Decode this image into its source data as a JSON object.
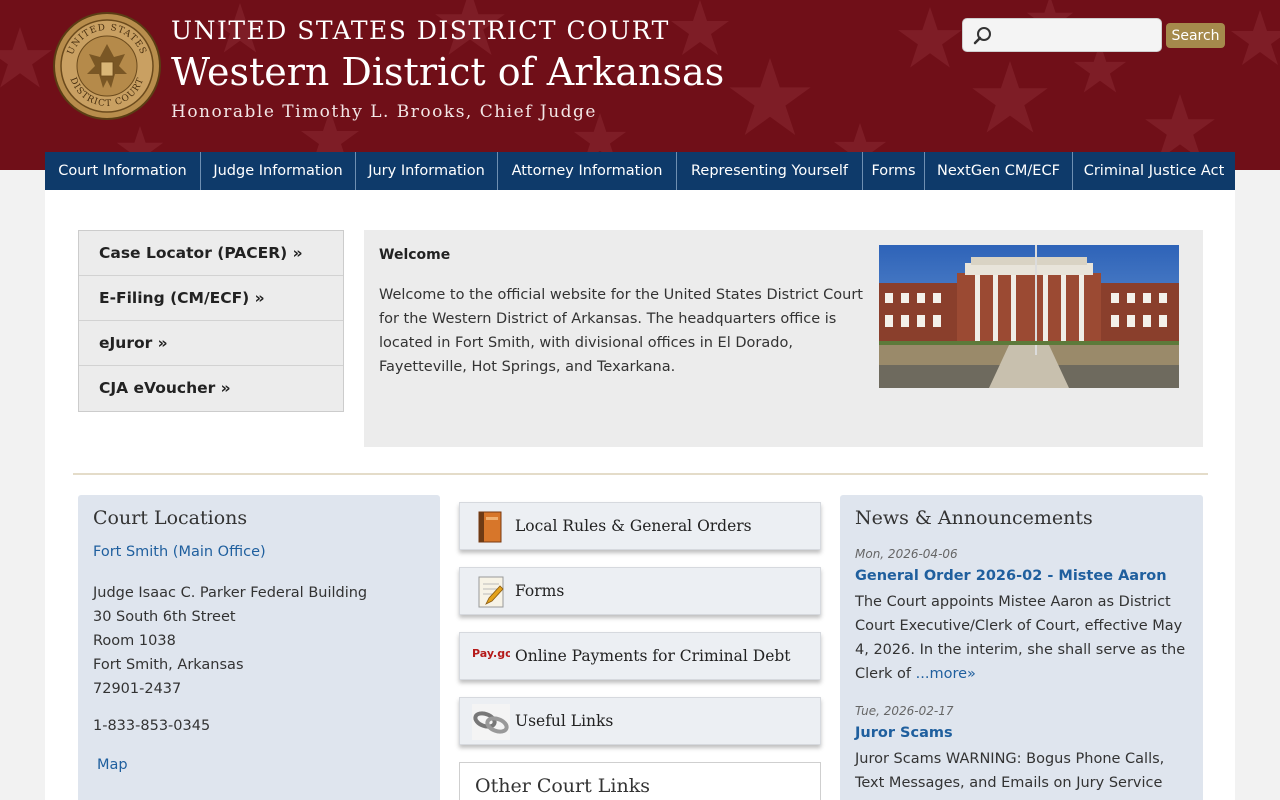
{
  "header": {
    "court_line": "UNITED STATES DISTRICT COURT",
    "district": "Western District of Arkansas",
    "chief_judge": "Honorable Timothy L. Brooks, Chief Judge",
    "search_placeholder": "",
    "search_button": "Search",
    "seal_text_top": "UNITED STATES",
    "seal_text_bottom": "DISTRICT COURT"
  },
  "nav": [
    "Court Information",
    "Judge Information",
    "Jury Information",
    "Attorney Information",
    "Representing Yourself",
    "Forms",
    "NextGen CM/ECF",
    "Criminal Justice Act"
  ],
  "quick_links": [
    "Case Locator (PACER) »",
    "E-Filing (CM/ECF) »",
    "eJuror »",
    "CJA eVoucher »"
  ],
  "welcome": {
    "title": "Welcome",
    "text": "Welcome to the official website for the United States District Court for the Western District of Arkansas. The headquarters office is located in Fort Smith, with divisional offices in El Dorado, Fayetteville, Hot Springs, and Texarkana."
  },
  "locations": {
    "title": "Court Locations",
    "office": "Fort Smith (Main Office)",
    "address": [
      "Judge Isaac C. Parker Federal Building",
      "30 South 6th Street",
      "Room 1038",
      "Fort Smith, Arkansas",
      "72901-2437"
    ],
    "phone": "1-833-853-0345",
    "map": "Map"
  },
  "middle_links": [
    {
      "label": "Local Rules & General Orders",
      "icon": "book-icon"
    },
    {
      "label": "Forms",
      "icon": "form-pencil-icon"
    },
    {
      "label": "Online Payments for Criminal Debt",
      "icon": "paygov-icon",
      "icon_text": "Pay.gov"
    },
    {
      "label": "Useful Links",
      "icon": "chain-link-icon"
    }
  ],
  "other_links": {
    "title": "Other Court Links"
  },
  "news": {
    "title": "News & Announcements",
    "items": [
      {
        "date": "Mon, 2026-04-06",
        "headline": "General Order 2026-02 - Mistee Aaron",
        "body": "The Court appoints Mistee Aaron as District Court Executive/Clerk of Court, effective May 4, 2026. In the interim, she shall serve as the Clerk of ",
        "more": "...more»"
      },
      {
        "date": "Tue, 2026-02-17",
        "headline": "Juror Scams",
        "body": "Juror Scams WARNING: Bogus Phone Calls, Text Messages, and Emails on Jury Service May Lead"
      }
    ]
  },
  "colors": {
    "header_bg": "#700f18",
    "nav_bg": "#0e3a6a",
    "link": "#1f5f9e",
    "search_button": "#a58a4c"
  }
}
